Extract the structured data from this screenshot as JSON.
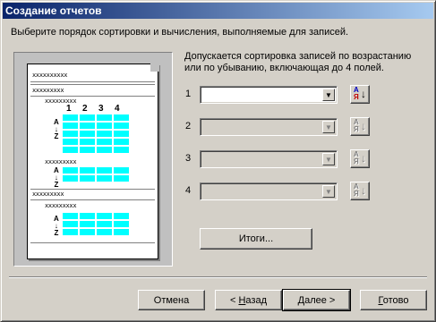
{
  "window": {
    "title": "Создание отчетов"
  },
  "intro": "Выберите порядок сортировки и вычисления, выполняемые для записей.",
  "description": "Допускается сортировка записей по возрастанию или по убыванию, включающая до 4 полей.",
  "sort_fields": [
    {
      "number": "1",
      "value": "",
      "enabled": true
    },
    {
      "number": "2",
      "value": "",
      "enabled": false
    },
    {
      "number": "3",
      "value": "",
      "enabled": false
    },
    {
      "number": "4",
      "value": "",
      "enabled": false
    }
  ],
  "sort_button": {
    "top": "А",
    "bottom": "Я",
    "arrow": "↓"
  },
  "combo_arrow": "▼",
  "summary_button": {
    "label": "Итоги..."
  },
  "preview": {
    "header": "xxxxxxxxxx",
    "group": "xxxxxxxxx",
    "subgroup": "xxxxxxxxx",
    "cell": "xxxx",
    "columns": [
      "1",
      "2",
      "3",
      "4"
    ],
    "az": [
      "А",
      "↓",
      "Z"
    ]
  },
  "footer": {
    "cancel": "Отмена",
    "back_prefix": "< ",
    "back_underline": "Н",
    "back_rest": "азад",
    "next_underline": "Д",
    "next_rest": "алее >",
    "finish_underline": "Г",
    "finish_rest": "отово"
  },
  "colors": {
    "accent": "#0a246a",
    "cell": "#00ffff",
    "face": "#d4d0c8"
  }
}
